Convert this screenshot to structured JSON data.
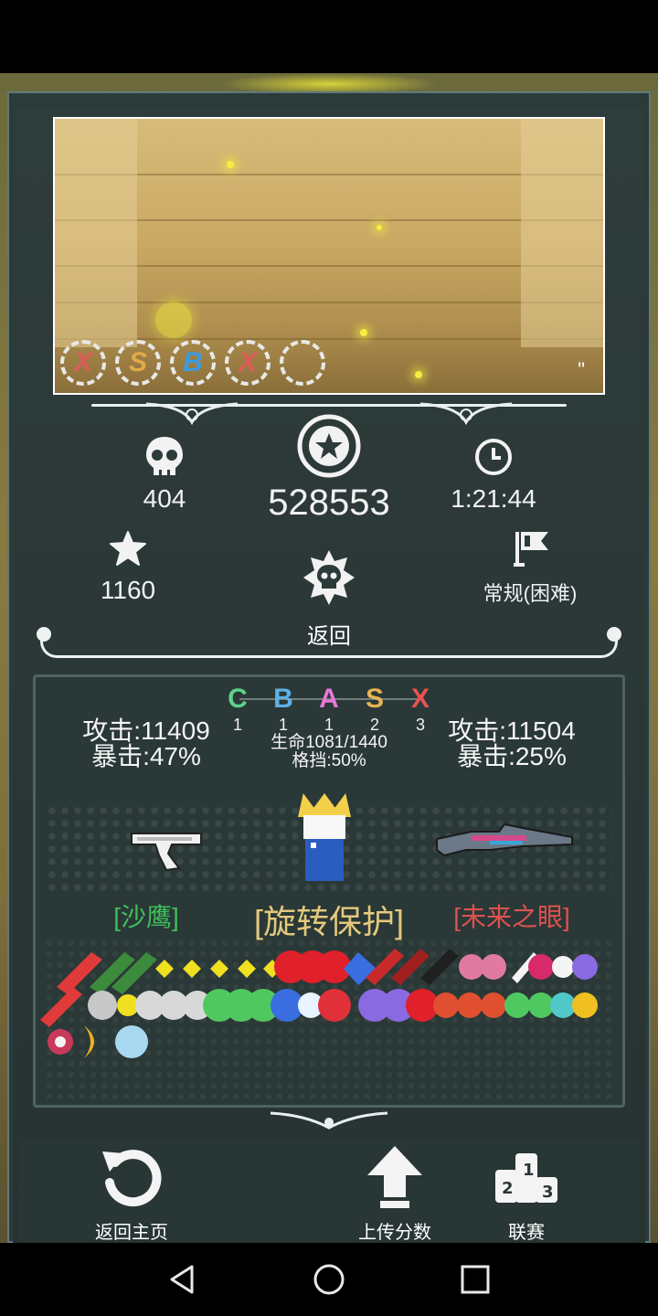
{
  "preview": {
    "ranks": [
      {
        "letter": "X",
        "color": "#e05a5a"
      },
      {
        "letter": "S",
        "color": "#e0a94a"
      },
      {
        "letter": "B",
        "color": "#3a9ce0"
      },
      {
        "letter": "X",
        "color": "#e05a5a"
      },
      {
        "letter": "",
        "color": "#ffffff"
      }
    ],
    "corner_mark": "\""
  },
  "stats": {
    "kills": "404",
    "score": "528553",
    "time": "1:21:44",
    "stars": "1160",
    "mode": "常规(困难)",
    "back_label": "返回"
  },
  "grades": [
    {
      "letter": "C",
      "count": "1",
      "color": "#5fd08a"
    },
    {
      "letter": "B",
      "count": "1",
      "color": "#5fb1e6"
    },
    {
      "letter": "A",
      "count": "1",
      "color": "#e877d8"
    },
    {
      "letter": "S",
      "count": "2",
      "color": "#e8b352"
    },
    {
      "letter": "X",
      "count": "3",
      "color": "#e8534f"
    }
  ],
  "loadout": {
    "left_attack": "攻击:11409",
    "left_crit": "暴击:47%",
    "right_attack": "攻击:11504",
    "right_crit": "暴击:25%",
    "life": "生命1081/1440",
    "block": "格挡:50%",
    "left_weapon": "[沙鹰]",
    "skill": "[旋转保护]",
    "right_weapon": "[未来之眼]"
  },
  "colors": {
    "left_weapon": "#3fbf5b",
    "right_weapon": "#e0524e",
    "skill": "#e4c97c"
  },
  "buttons": {
    "home": "返回主页",
    "upload": "上传分数",
    "league": "联赛"
  },
  "icons": [
    "skull-icon",
    "star-badge-icon",
    "clock-icon",
    "star-icon",
    "flag-icon",
    "skull-star-icon",
    "undo-icon",
    "upload-arrow-icon",
    "podium-icon"
  ]
}
